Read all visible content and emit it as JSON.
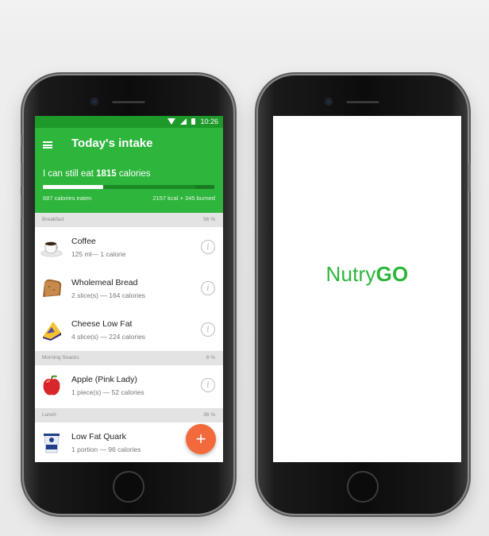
{
  "status_bar": {
    "time": "10:26"
  },
  "app": {
    "title": "Today's intake",
    "remaining_prefix": "I can still eat",
    "remaining_value": "1815",
    "remaining_suffix": "calories",
    "eaten_text": "687 calories eaten",
    "budget_text": "2157 kcal + 345 burned",
    "progress_fraction": 0.35
  },
  "sections": [
    {
      "name": "Breakfast",
      "percent": "56 %",
      "items": [
        {
          "name": "Coffee",
          "detail": "125 ml—   1 calorie",
          "icon": "coffee-cup-icon"
        },
        {
          "name": "Wholemeal Bread",
          "detail": "2 slice(s)  —  164 calories",
          "icon": "bread-icon"
        },
        {
          "name": "Cheese Low Fat",
          "detail": "4 slice(s)  —  224 calories",
          "icon": "cheese-icon"
        }
      ]
    },
    {
      "name": "Morning Snacks",
      "percent": "8 %",
      "items": [
        {
          "name": "Apple (Pink Lady)",
          "detail": "1 piece(s)  —  52 calories",
          "icon": "apple-icon"
        }
      ]
    },
    {
      "name": "Lunch",
      "percent": "36 %",
      "items": [
        {
          "name": "Low Fat Quark",
          "detail": "1 portion  —  96 calories",
          "icon": "quark-cup-icon"
        }
      ]
    }
  ],
  "fab_label": "+",
  "info_glyph": "i",
  "splash": {
    "brand_light": "Nutry",
    "brand_bold": "GO"
  },
  "colors": {
    "green": "#2db53c",
    "dark_green": "#1e9a2a",
    "fab": "#f26a3b"
  }
}
